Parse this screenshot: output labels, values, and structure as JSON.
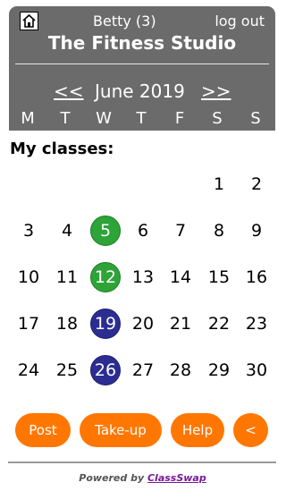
{
  "header": {
    "home_icon": "home-icon",
    "user": "Betty (3)",
    "logout": "log out",
    "studio": "The Fitness Studio",
    "prev": "<<",
    "month": "June 2019",
    "next": ">>",
    "weekdays": [
      "M",
      "T",
      "W",
      "T",
      "F",
      "S",
      "S"
    ]
  },
  "classes_title": "My classes:",
  "calendar": {
    "weeks": [
      [
        "",
        "",
        "",
        "",
        "",
        "1",
        "2"
      ],
      [
        "3",
        "4",
        "5",
        "6",
        "7",
        "8",
        "9"
      ],
      [
        "10",
        "11",
        "12",
        "13",
        "14",
        "15",
        "16"
      ],
      [
        "17",
        "18",
        "19",
        "20",
        "21",
        "22",
        "23"
      ],
      [
        "24",
        "25",
        "26",
        "27",
        "28",
        "29",
        "30"
      ]
    ],
    "highlight_green": [
      "5",
      "12"
    ],
    "highlight_blue": [
      "19",
      "26"
    ],
    "colors": {
      "green": "#2ea337",
      "blue": "#2b2d91",
      "accent": "#ff7700"
    }
  },
  "buttons": {
    "post": "Post",
    "takeup": "Take-up",
    "help": "Help",
    "back": "<"
  },
  "footer": {
    "powered": "Powered by",
    "brand": "ClassSwap"
  }
}
